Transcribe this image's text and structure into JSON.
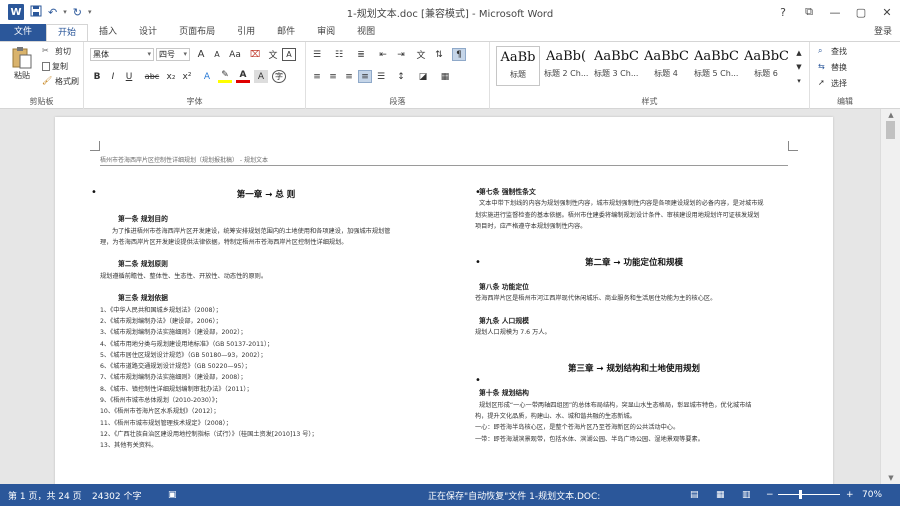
{
  "window": {
    "title": "1-规划文本.doc [兼容模式] - Microsoft Word",
    "controls": [
      "?",
      "⧉",
      "—",
      "▢",
      "✕"
    ],
    "login": "登录"
  },
  "tabs": [
    "文件",
    "开始",
    "插入",
    "设计",
    "页面布局",
    "引用",
    "邮件",
    "审阅",
    "视图"
  ],
  "ribbon": {
    "clipboard": {
      "label": "剪贴板",
      "paste": "粘贴",
      "cut": "剪切",
      "copy": "复制",
      "format_painter": "格式刷"
    },
    "font": {
      "label": "字体",
      "font_name": "黑体",
      "font_size": "四号",
      "grow": "A",
      "shrink": "A",
      "case": "Aa",
      "bold": "B",
      "italic": "I",
      "underline": "U",
      "strike": "abc",
      "subscript": "x₂",
      "superscript": "x²"
    },
    "paragraph": {
      "label": "段落"
    },
    "styles": {
      "label": "样式",
      "items": [
        {
          "sample": "AaBb",
          "name": "标题"
        },
        {
          "sample": "AaBb(",
          "name": "标题 2 Ch..."
        },
        {
          "sample": "AaBbC",
          "name": "标题 3 Ch..."
        },
        {
          "sample": "AaBbC",
          "name": "标题 4"
        },
        {
          "sample": "AaBbC",
          "name": "标题 5 Ch..."
        },
        {
          "sample": "AaBbCc",
          "name": "标题 6"
        }
      ]
    },
    "editing": {
      "label": "编辑",
      "find": "查找",
      "replace": "替换",
      "select": "选择"
    }
  },
  "document": {
    "header": "梧州市苍海西岸片区控制性详细规划（规划报批稿） - 规划文本",
    "left": {
      "chapter": "第一章  →  总  则",
      "a1_title": "第一条  规划目的",
      "a1_text1": "为了推进梧州市苍海西岸片区开发建设，统筹安排规划范围内的土地使用和各项建设，加强城市规划管",
      "a1_text2": "理，为苍海西岸片区开发建设提供法律依据，特制定梧州市苍海西岸片区控制性详细规划。",
      "a2_title": "第二条  规划原则",
      "a2_text": "规划遵循前瞻性、整体性、生态性、开放性、动态性的原则。",
      "a3_title": "第三条  规划依据",
      "basis": [
        "1、《中华人民共和国城乡规划法》（2008）；",
        "2、《城市规划编制办法》（建设部，2006）；",
        "3、《城市规划编制办法实施细则》（建设部，2002）；",
        "4、《城市用地分类与规划建设用地标准》（GB 50137-2011）；",
        "5、《城市居住区规划设计规范》（GB 50180—93，2002）；",
        "6、《城市道路交通规划设计规范》（GB 50220—95）；",
        "7、《城市规划编制办法实施细则》（建设部，2008）；",
        "8、《城市、镇控制性详细规划编制审批办法》（2011）；",
        "9、《梧州市城市总体规划（2010-2030）》；",
        "10、《梧州市苍海片区水系规划》（2012）；",
        "11、《梧州市城市规划管理技术规定》（2008）；",
        "12、《广西壮族自治区建设用地控制指标（试行）》（桂国土资发[2010]13 号）；",
        "13、其他有关资料。"
      ]
    },
    "right": {
      "a7_title": "第七条  强制性条文",
      "a7_text1": "文本中带下划线的内容为规划强制性内容，城市规划强制性内容是各项建设规划的必备内容，是对城市规",
      "a7_text2": "划实施进行监督检查的基本依据。梧州市住建委将编制规划设计条件、审核建设用地规划许可证核发规划",
      "a7_text3": "项目时，应严格遵守本规划强制性内容。",
      "chapter2": "第二章  →  功能定位和规模",
      "a8_title": "第八条  功能定位",
      "a8_text": "苍海西岸片区是梧州市河江西岸现代休闲城乐、商业服务和生活居住功能为主的核心区。",
      "a9_title": "第九条  人口规模",
      "a9_text": "规划人口规模为 7.6 万人。",
      "chapter3": "第三章  →  规划结构和土地使用规划",
      "a10_title": "第十条  规划结构",
      "a10_text1": "规划区形成“一心一带两轴四组团”的总体布局结构，突显山水生态格局，彰显城市特色，优化城市结",
      "a10_text2": "构，提升文化品质，构建山、水、城和谐共融的生态新城。",
      "a10_text3": "一心：即苍海半岛核心区，是整个苍海片区乃至苍海新区的公共活动中心。",
      "a10_text4": "一带：即苍海湖滨景观带，包括水体、滨湖公园、半岛广场公园、湿地景观等要素。"
    }
  },
  "status": {
    "page": "第 1 页，共 24 页",
    "words": "24302 个字",
    "autosave": "正在保存\"自动恢复\"文件 1-规划文本.DOC:",
    "zoom": "70%",
    "zoom_level": 0.7
  },
  "colors": {
    "brand": "#2b579a"
  }
}
